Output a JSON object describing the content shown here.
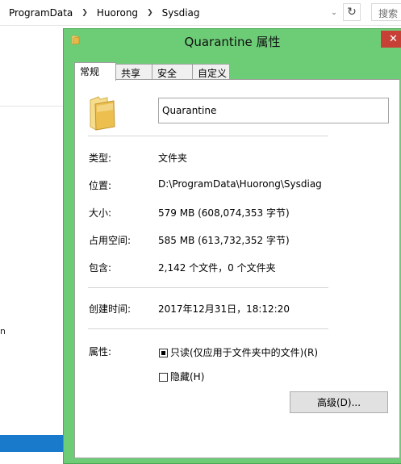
{
  "explorer": {
    "breadcrumb": [
      "ProgramData",
      "Huorong",
      "Sysdiag"
    ],
    "search_placeholder": "搜索",
    "nav_stray_char": "n"
  },
  "dialog": {
    "title": "Quarantine 属性",
    "close_glyph": "✕",
    "tabs": [
      "常规",
      "共享",
      "安全",
      "自定义"
    ],
    "active_tab": "常规",
    "name_value": "Quarantine",
    "fields": {
      "type": {
        "label": "类型:",
        "value": "文件夹"
      },
      "location": {
        "label": "位置:",
        "value": "D:\\ProgramData\\Huorong\\Sysdiag"
      },
      "size": {
        "label": "大小:",
        "value": "579 MB (608,074,353 字节)"
      },
      "size_on_disk": {
        "label": "占用空间:",
        "value": "585 MB (613,732,352 字节)"
      },
      "contains": {
        "label": "包含:",
        "value": "2,142 个文件，0 个文件夹"
      },
      "created": {
        "label": "创建时间:",
        "value": "2017年12月31日，18:12:20"
      }
    },
    "attributes": {
      "label": "属性:",
      "readonly_label": "只读(仅应用于文件夹中的文件)(R)",
      "readonly_state": "indeterminate",
      "hidden_label": "隐藏(H)",
      "hidden_state": "unchecked",
      "advanced_button": "高级(D)..."
    }
  },
  "colors": {
    "dialog_frame": "#6dcd77",
    "close_button": "#c74036",
    "taskbar": "#1979ca"
  }
}
